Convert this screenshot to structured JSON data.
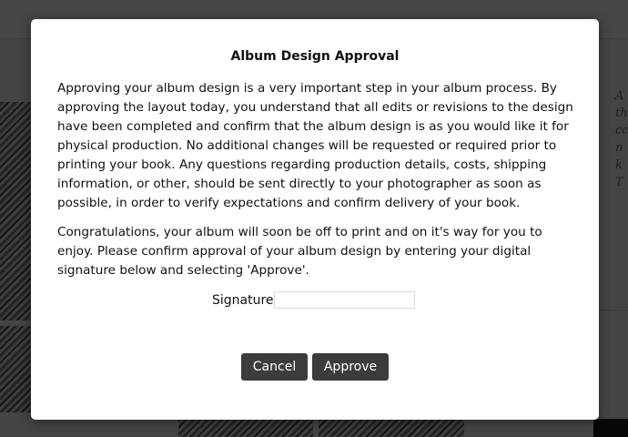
{
  "background": {
    "side_text": [
      "A",
      "th",
      "cc",
      "n",
      "k",
      "T"
    ]
  },
  "dialog": {
    "title": "Album Design Approval",
    "paragraphs": [
      "Approving your album design is a very important step in your album process. By approving the layout today, you understand that all edits or revisions to the design have been completed and confirm that the album design is as you would like it for physical production. No additional changes will be requested or required prior to printing your book. Any questions regarding production details, costs, shipping information, or other, should be sent directly to your photographer as soon as possible, in order to verify expectations and confirm delivery of your book.",
      "Congratulations, your album will soon be off to print and on it's way for you to enjoy. Please confirm approval of your album design by entering your digital signature below and selecting 'Approve'."
    ],
    "signature": {
      "label": "Signature",
      "value": "",
      "placeholder": ""
    },
    "buttons": {
      "cancel": "Cancel",
      "approve": "Approve"
    }
  },
  "colors": {
    "button_bg": "#3c3c3c",
    "overlay": "rgba(0,0,0,0.72)"
  }
}
